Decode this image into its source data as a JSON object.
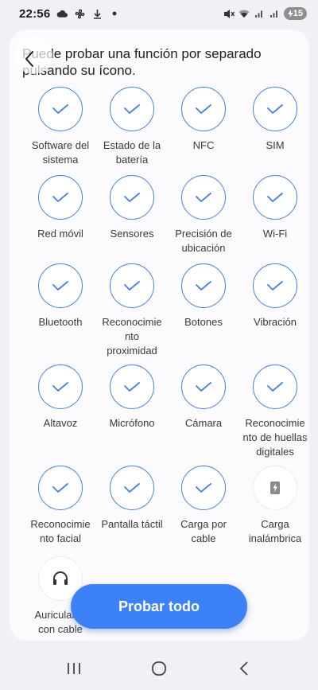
{
  "status_bar": {
    "time": "22:56",
    "battery": "15",
    "left_icons": [
      "cloud-icon",
      "fan-icon",
      "download-icon",
      "dot-icon"
    ],
    "right_icons": [
      "mute-icon",
      "wifi-icon",
      "signal-icon",
      "signal-icon"
    ]
  },
  "header": {
    "instruction_line1": "Puede probar una función por separado",
    "instruction_line2": "pulsando su ícono."
  },
  "tests": [
    {
      "label": "Software del\nsistema",
      "status": "passed"
    },
    {
      "label": "Estado de la\nbatería",
      "status": "passed"
    },
    {
      "label": "NFC",
      "status": "passed"
    },
    {
      "label": "SIM",
      "status": "passed"
    },
    {
      "label": "Red móvil",
      "status": "passed"
    },
    {
      "label": "Sensores",
      "status": "passed"
    },
    {
      "label": "Precisión de\nubicación",
      "status": "passed"
    },
    {
      "label": "Wi-Fi",
      "status": "passed"
    },
    {
      "label": "Bluetooth",
      "status": "passed"
    },
    {
      "label": "Reconocimie\nnto\nproximidad",
      "status": "passed"
    },
    {
      "label": "Botones",
      "status": "passed"
    },
    {
      "label": "Vibración",
      "status": "passed"
    },
    {
      "label": "Altavoz",
      "status": "passed"
    },
    {
      "label": "Micrófono",
      "status": "passed"
    },
    {
      "label": "Cámara",
      "status": "passed"
    },
    {
      "label": "Reconocimie\nnto de huellas\ndigitales",
      "status": "passed"
    },
    {
      "label": "Reconocimie\nnto facial",
      "status": "passed"
    },
    {
      "label": "Pantalla táctil",
      "status": "passed"
    },
    {
      "label": "Carga por\ncable",
      "status": "passed"
    },
    {
      "label": "Carga\ninalámbrica",
      "status": "untested",
      "icon": "wireless-charging-icon"
    },
    {
      "label": "Auriculares\ncon cable",
      "status": "untested",
      "icon": "headphones-icon"
    }
  ],
  "actions": {
    "test_all_label": "Probar todo"
  },
  "colors": {
    "accent": "#3c82f6",
    "check": "#4a7fe0"
  }
}
